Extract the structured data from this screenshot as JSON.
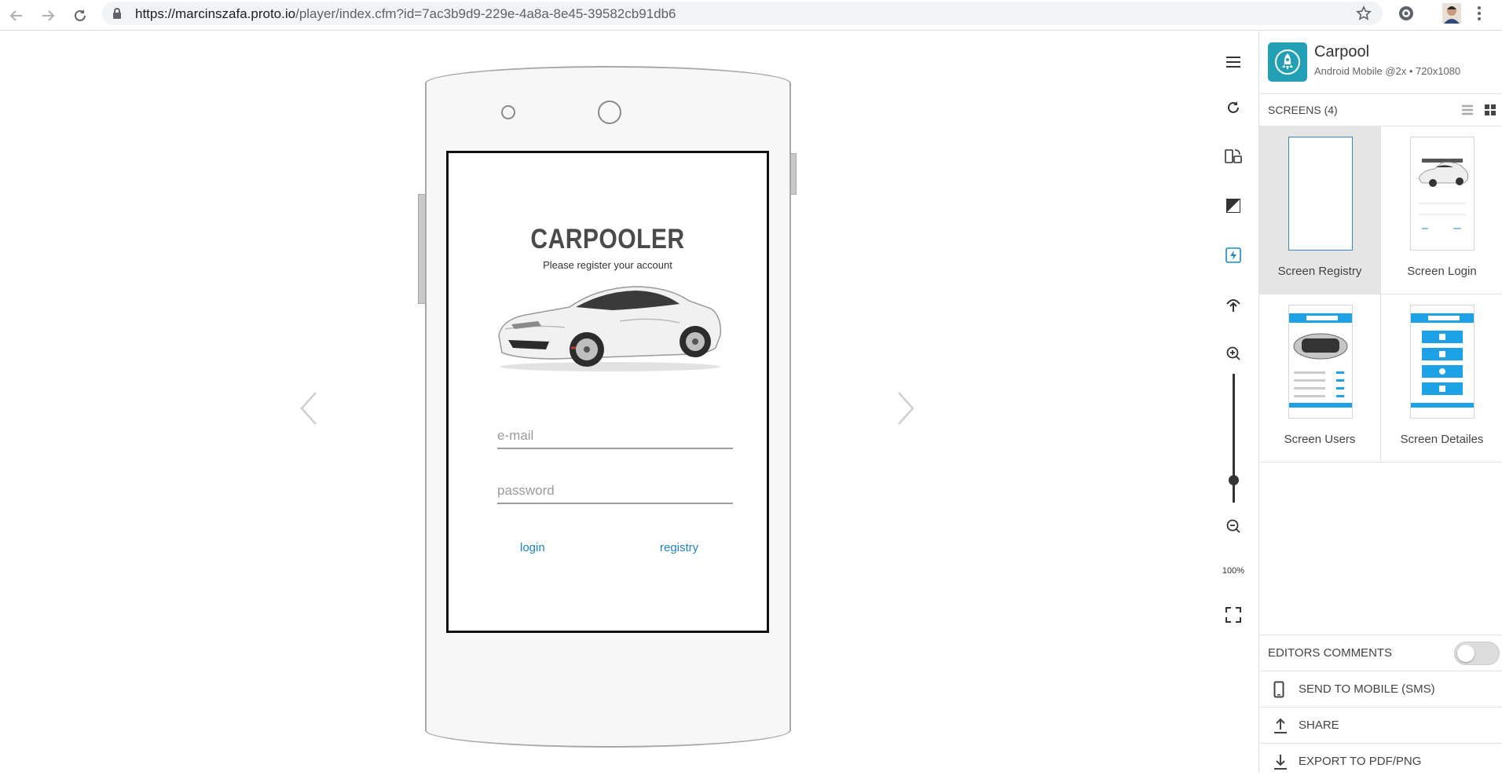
{
  "browser": {
    "url_host": "https://marcinszafa.proto.io",
    "url_path": "/player/index.cfm?id=7ac3b9d9-229e-4a8a-8e45-39582cb91db6",
    "icons": [
      "back-arrow-icon",
      "forward-arrow-icon",
      "reload-icon",
      "lock-icon",
      "star-icon",
      "extension-icon",
      "profile-avatar",
      "kebab-menu-icon"
    ]
  },
  "prototype": {
    "title": "CARPOOLER",
    "subtitle": "Please register your account",
    "email_placeholder": "e-mail",
    "password_placeholder": "password",
    "login_label": "login",
    "registry_label": "registry"
  },
  "toolbar": {
    "zoom_label": "100%",
    "zoom_level_percent": 100
  },
  "panel": {
    "project_name": "Carpool",
    "project_meta": "Android Mobile @2x • 720x1080",
    "screens_label": "SCREENS (4)",
    "screens": [
      {
        "name": "Screen Registry",
        "selected": true
      },
      {
        "name": "Screen Login",
        "selected": false
      },
      {
        "name": "Screen Users",
        "selected": false
      },
      {
        "name": "Screen Detailes",
        "selected": false
      }
    ],
    "editors_comments_label": "EDITORS COMMENTS",
    "editors_comments_on": false,
    "send_to_mobile_label": "SEND TO MOBILE (SMS)",
    "share_label": "SHARE",
    "export_label": "EXPORT TO PDF/PNG"
  },
  "colors": {
    "accent": "#1a87c9",
    "project_icon": "#23a0b5",
    "thumb_bar": "#1ca0e6"
  }
}
